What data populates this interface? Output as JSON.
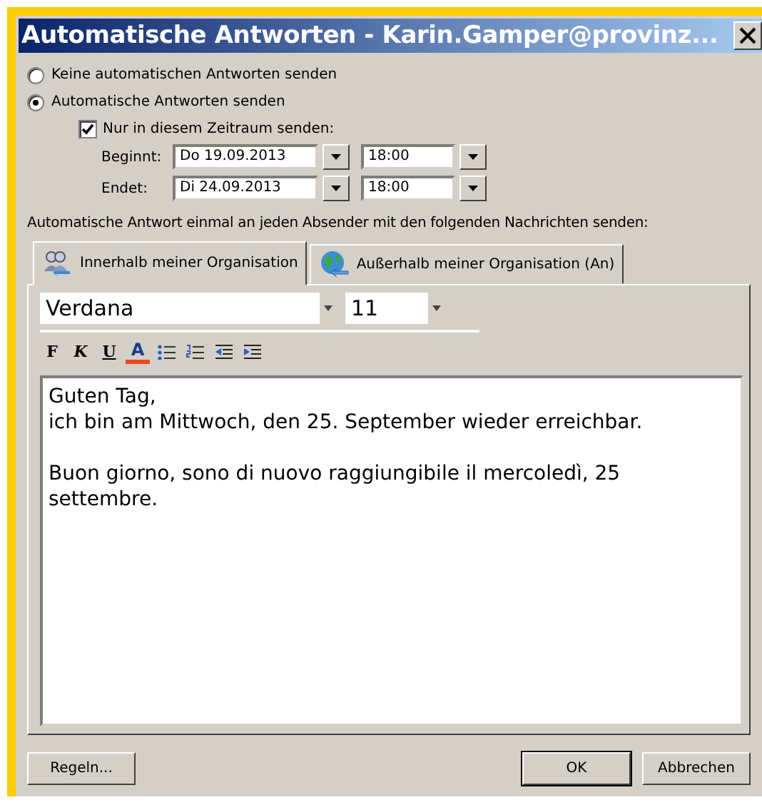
{
  "window": {
    "title": "Automatische Antworten - Karin.Gamper@provinz..."
  },
  "reply_modes": [
    {
      "label": "Keine automatischen Antworten senden",
      "selected": false
    },
    {
      "label": "Automatische Antworten senden",
      "selected": true
    }
  ],
  "period": {
    "label": "Nur in diesem Zeitraum senden:",
    "checked": true,
    "rows": [
      {
        "label": "Beginnt:",
        "date": "Do 19.09.2013",
        "time": "18:00"
      },
      {
        "label": "Endet:",
        "date": "Di 24.09.2013",
        "time": "18:00"
      }
    ]
  },
  "instruction": "Automatische Antwort einmal an jeden Absender mit den folgenden Nachrichten senden:",
  "tabs": [
    {
      "label": "Innerhalb meiner Organisation",
      "selected": true,
      "kind": "people"
    },
    {
      "label": "Außerhalb meiner Organisation (An)",
      "selected": false,
      "kind": "globe"
    }
  ],
  "font": {
    "family": "Verdana",
    "size": "11"
  },
  "format_buttons": [
    {
      "kind": "bold",
      "label": "F"
    },
    {
      "kind": "italic",
      "label": "K"
    },
    {
      "kind": "underline",
      "label": "U"
    },
    {
      "kind": "color",
      "label": "A"
    },
    {
      "kind": "bullets"
    },
    {
      "kind": "numbering"
    },
    {
      "kind": "outdent"
    },
    {
      "kind": "indent"
    }
  ],
  "message": [
    [
      "Guten Tag,",
      "ich bin am Mittwoch, den 25. September wieder erreichbar."
    ],
    [
      "Buon giorno, sono di nuovo raggiungibile il mercoledì, 25 settembre."
    ]
  ],
  "buttons": [
    {
      "label": "Regeln...",
      "default": false
    },
    {
      "label": "OK",
      "default": true
    },
    {
      "label": "Abbrechen",
      "default": false
    }
  ]
}
